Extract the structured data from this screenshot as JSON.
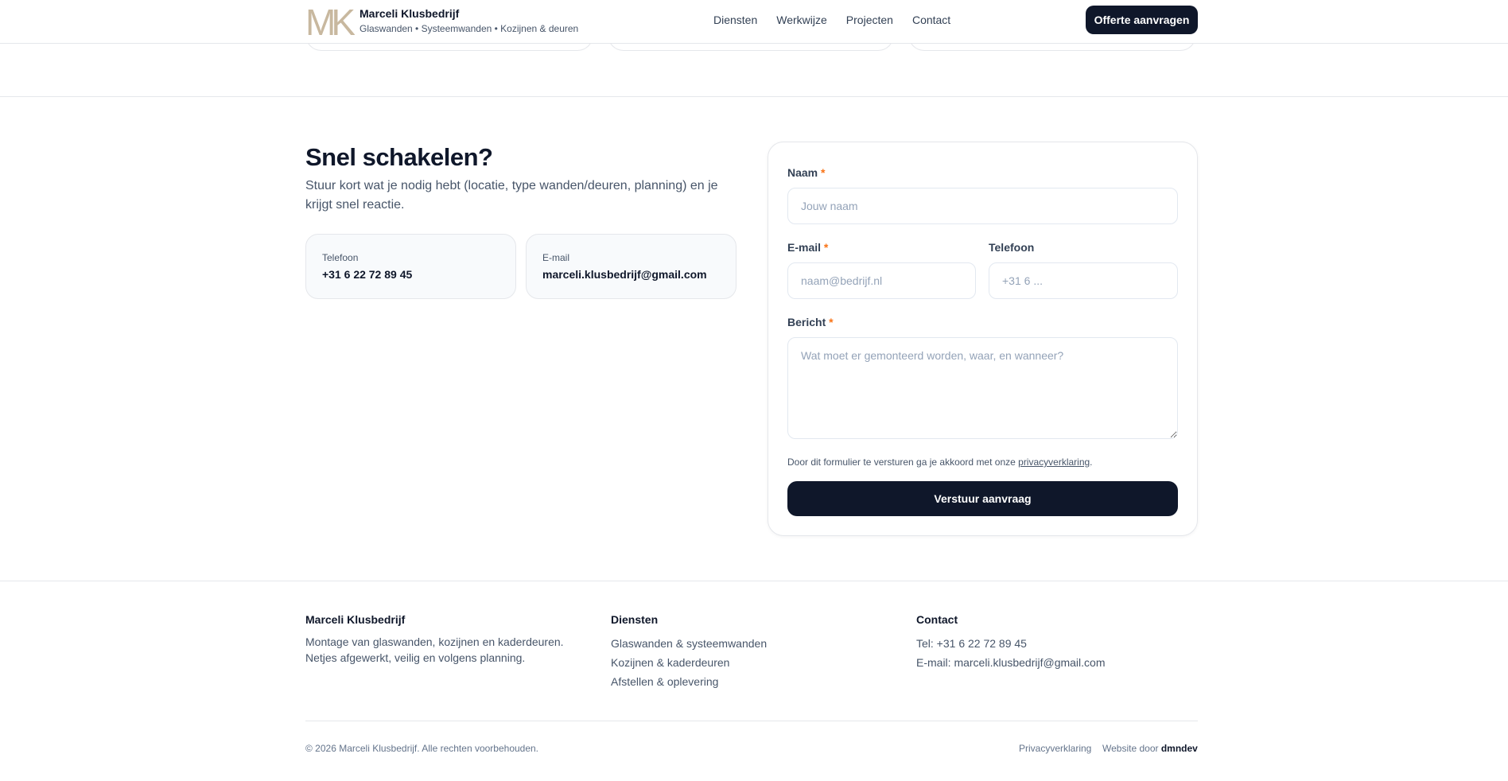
{
  "header": {
    "brand_name": "Marceli Klusbedrijf",
    "brand_tagline": "Glaswanden • Systeemwanden • Kozijnen & deuren",
    "logo_letters": "MK",
    "logo_color": "#c8b89f",
    "nav": [
      "Diensten",
      "Werkwijze",
      "Projecten",
      "Contact"
    ],
    "cta_label": "Offerte aanvragen"
  },
  "contact": {
    "title": "Snel schakelen?",
    "lead": "Stuur kort wat je nodig hebt (locatie, type wanden/deuren, planning) en je krijgt snel reactie.",
    "phone_label": "Telefoon",
    "phone_value": "+31 6 22 72 89 45",
    "email_label": "E-mail",
    "email_value": "marceli.klusbedrijf@gmail.com"
  },
  "form": {
    "name_label": "Naam",
    "name_placeholder": "Jouw naam",
    "email_label": "E-mail",
    "email_placeholder": "naam@bedrijf.nl",
    "phone_label": "Telefoon",
    "phone_placeholder": "+31 6 ...",
    "message_label": "Bericht",
    "message_placeholder": "Wat moet er gemonteerd worden, waar, en wanneer?",
    "required_mark": "*",
    "consent_text": "Door dit formulier te versturen ga je akkoord met onze ",
    "consent_link": "privacyverklaring",
    "consent_end": ".",
    "submit_label": "Verstuur aanvraag"
  },
  "footer": {
    "about_title": "Marceli Klusbedrijf",
    "about_text": "Montage van glaswanden, kozijnen en kaderdeuren. Netjes afgewerkt, veilig en volgens planning.",
    "services_title": "Diensten",
    "services": [
      "Glaswanden & systeemwanden",
      "Kozijnen & kaderdeuren",
      "Afstellen & oplevering"
    ],
    "contact_title": "Contact",
    "contact_phone": "Tel: +31 6 22 72 89 45",
    "contact_email": "E-mail: marceli.klusbedrijf@gmail.com",
    "copyright": "© 2026 Marceli Klusbedrijf. Alle rechten voorbehouden.",
    "privacy_link": "Privacyverklaring",
    "credit_prefix": "Website door ",
    "credit_name": "dmndev"
  },
  "colors": {
    "primary": "#0f172a",
    "required": "#f97316",
    "muted": "#475569"
  }
}
